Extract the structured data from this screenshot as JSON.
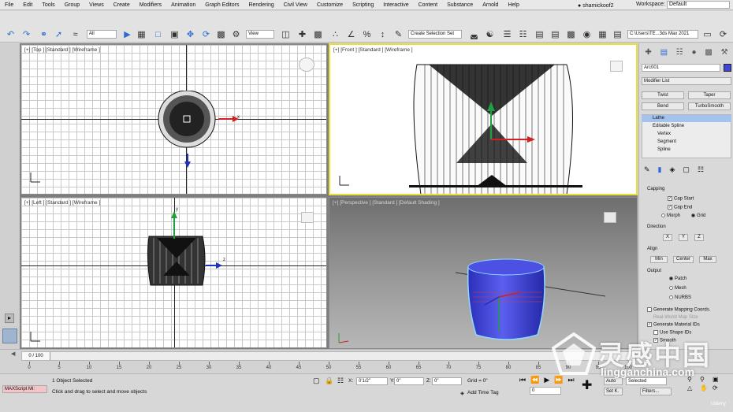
{
  "menu": {
    "items": [
      "File",
      "Edit",
      "Tools",
      "Group",
      "Views",
      "Create",
      "Modifiers",
      "Animation",
      "Graph Editors",
      "Rendering",
      "Civil View",
      "Customize",
      "Scripting",
      "Interactive",
      "Content",
      "Substance",
      "Arnold",
      "Help"
    ],
    "user": "shamickoof2",
    "workspace_label": "Workspace:",
    "workspace_value": "Default"
  },
  "toolbar": {
    "selection_filter": "All",
    "ref_coord": "View",
    "named_selection": "Create Selection Set",
    "project_path": "C:\\Users\\TE...3ds Max 2021"
  },
  "viewports": {
    "top": {
      "label": "[+] [Top ] [Standard ] [Wireframe ]"
    },
    "front": {
      "label": "[+] [Front ] [Standard ] [Wireframe ]"
    },
    "left": {
      "label": "[+] [Left ] [Standard ] [Wireframe ]"
    },
    "perspective": {
      "label": "[+] [Perspective ] [Standard ] [Default Shading ]"
    },
    "axis_x": "x",
    "axis_y": "y",
    "axis_z": "z"
  },
  "command_panel": {
    "object_name": "Arc001",
    "modifier_list": "Modifier List",
    "mod_buttons": [
      "Twist",
      "Taper",
      "Bend",
      "TurboSmooth"
    ],
    "stack": [
      {
        "label": "Lathe",
        "active": true
      },
      {
        "label": "Editable Spline",
        "active": false
      },
      {
        "label": "Vertex",
        "active": false
      },
      {
        "label": "Segment",
        "active": false
      },
      {
        "label": "Spline",
        "active": false
      }
    ],
    "capping": {
      "title": "Capping",
      "cap_start": "Cap Start",
      "cap_end": "Cap End",
      "morph": "Morph",
      "grid": "Grid"
    },
    "direction": {
      "title": "Direction",
      "buttons": [
        "X",
        "Y",
        "Z"
      ]
    },
    "align": {
      "title": "Align",
      "buttons": [
        "Min",
        "Center",
        "Max"
      ]
    },
    "output": {
      "title": "Output",
      "options": [
        "Patch",
        "Mesh",
        "NURBS"
      ],
      "selected": "Patch"
    },
    "gen_mapping": "Generate Mapping Coords.",
    "real_world": "Real-World Map Size",
    "gen_material": "Generate Material IDs",
    "use_shape_ids": "Use Shape IDs",
    "smooth": "Smooth"
  },
  "timeline": {
    "frame_display": "0 / 100",
    "ticks": [
      "0",
      "5",
      "10",
      "15",
      "20",
      "25",
      "30",
      "35",
      "40",
      "45",
      "50",
      "55",
      "60",
      "65",
      "70",
      "75",
      "80",
      "85",
      "90",
      "95",
      "100"
    ]
  },
  "statusbar": {
    "maxscript": "MAXScript Mi:",
    "objects_selected": "1 Object Selected",
    "prompt": "Click and drag to select and move objects",
    "x_value": "0'1/2\"",
    "y_value": "0\"",
    "z_value": "0\"",
    "grid": "Grid = 0\"",
    "add_time_tag": "Add Time Tag",
    "auto": "Auto",
    "selected": "Selected",
    "set_k": "Set K.",
    "filters": "Filters...",
    "frame": "0"
  },
  "watermark": {
    "text": "灵感中国",
    "url": "lingganchina.com",
    "udemy": "Udemy"
  },
  "colors": {
    "object_blue": "#3f45d8",
    "axis_red": "#d02020",
    "axis_green": "#20a040",
    "axis_blue": "#2030c0",
    "active_viewport": "#e6df3a"
  }
}
